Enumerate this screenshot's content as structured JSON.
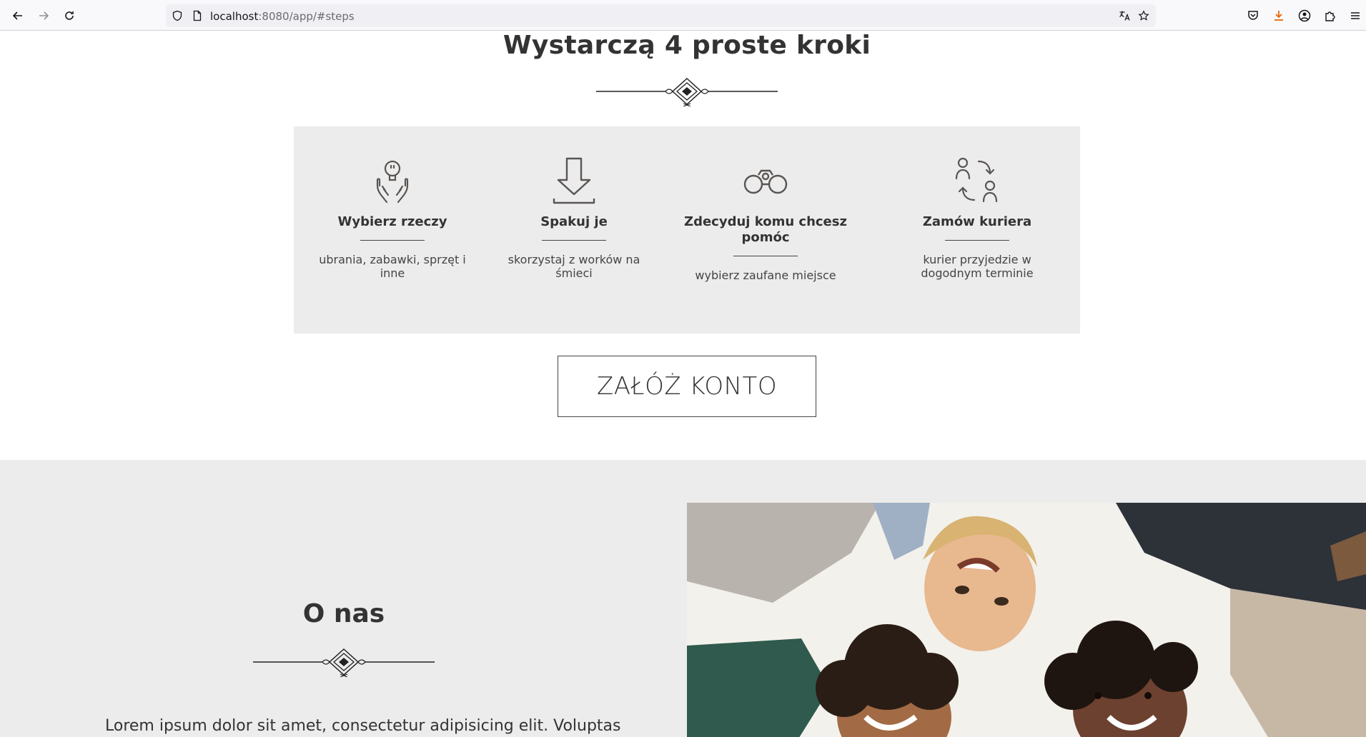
{
  "browser": {
    "url_host": "localhost",
    "url_rest": ":8080/app/#steps",
    "icons": [
      "back-arrow-icon",
      "forward-arrow-icon",
      "reload-icon",
      "shield-icon",
      "page-icon",
      "translate-icon",
      "bookmark-star-icon",
      "pocket-icon",
      "download-icon",
      "account-icon",
      "extensions-icon",
      "menu-icon"
    ]
  },
  "steps": {
    "title": "Wystarczą 4 proste kroki",
    "items": [
      {
        "icon": "hands-bulb-icon",
        "title": "Wybierz rzeczy",
        "desc": "ubrania, zabawki, sprzęt i inne"
      },
      {
        "icon": "down-arrow-icon",
        "title": "Spakuj je",
        "desc": "skorzystaj z worków na śmieci"
      },
      {
        "icon": "binoculars-icon",
        "title": "Zdecyduj komu chcesz pomóc",
        "desc": "wybierz zaufane miejsce"
      },
      {
        "icon": "people-exchange-icon",
        "title": "Zamów kuriera",
        "desc": "kurier przyjedzie w dogodnym terminie"
      }
    ],
    "cta_label": "ZAŁÓŻ KONTO"
  },
  "about": {
    "title": "O nas",
    "text": "Lorem ipsum dolor sit amet, consectetur adipisicing elit. Voluptas"
  },
  "colors": {
    "box_bg": "#ececec",
    "text_dark": "#333333",
    "icon_stroke": "#5a5552"
  }
}
